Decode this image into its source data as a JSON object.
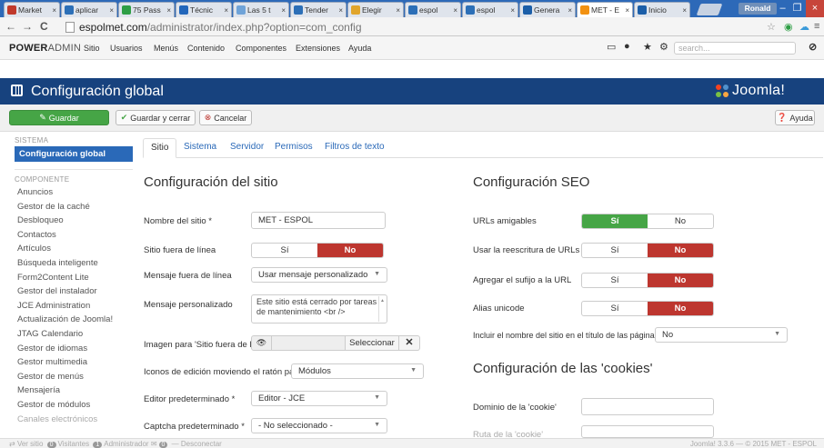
{
  "browser": {
    "tabs": [
      {
        "title": "Market",
        "color": "#c0392b",
        "active": false
      },
      {
        "title": "aplicar",
        "color": "#2c6fb7",
        "active": false
      },
      {
        "title": "75 Pass",
        "color": "#2e9e45",
        "active": false
      },
      {
        "title": "Técnic",
        "color": "#2266bb",
        "active": false
      },
      {
        "title": "Las 5 t",
        "color": "#6fa3d8",
        "active": false
      },
      {
        "title": "Tender",
        "color": "#2c6fb7",
        "active": false
      },
      {
        "title": "Elegir",
        "color": "#e1a52b",
        "active": false
      },
      {
        "title": "espol",
        "color": "#2c6fb7",
        "active": false
      },
      {
        "title": "espol",
        "color": "#2c6fb7",
        "active": false
      },
      {
        "title": "Genera",
        "color": "#1b5ea8",
        "active": false
      },
      {
        "title": "MET - E",
        "color": "#f29111",
        "active": true
      },
      {
        "title": "Inicio",
        "color": "#1b5ea8",
        "active": false
      }
    ],
    "tab_close": "×",
    "user": "Ronald",
    "window_controls": {
      "minimize": "–",
      "maximize": "❐",
      "close": "×"
    },
    "nav": {
      "back": "←",
      "forward": "→",
      "reload": "C"
    },
    "url_domain": "espolmet.com",
    "url_path": "/administrator/index.php?option=com_config",
    "ext_icons": [
      "☆",
      "◉",
      "☁",
      "≡"
    ]
  },
  "admin_bar": {
    "brand_a": "POWER",
    "brand_b": "ADMIN",
    "menu": [
      "Sitio",
      "Usuarios",
      "Menús",
      "Contenido",
      "Componentes",
      "Extensiones",
      "Ayuda"
    ],
    "search_placeholder": "search...",
    "icons": [
      "monitor-icon",
      "user-icon",
      "star-icon",
      "gear-icon",
      "joomla-icon"
    ]
  },
  "header": {
    "title": "Configuración global",
    "logo_text": "Joomla!"
  },
  "toolbar": {
    "save": "Guardar",
    "save_close": "Guardar y cerrar",
    "cancel": "Cancelar",
    "help": "Ayuda"
  },
  "sidebar": {
    "system_heading": "SISTEMA",
    "active_item": "Configuración global",
    "component_heading": "COMPONENTE",
    "items": [
      "Anuncios",
      "Gestor de la caché",
      "Desbloqueo",
      "Contactos",
      "Artículos",
      "Búsqueda inteligente",
      "Form2Content Lite",
      "Gestor del instalador",
      "JCE Administration",
      "Actualización de Joomla!",
      "JTAG Calendario",
      "Gestor de idiomas",
      "Gestor multimedia",
      "Gestor de menús",
      "Mensajería",
      "Gestor de módulos",
      "Canales electrónicos"
    ]
  },
  "tabs": [
    "Sitio",
    "Sistema",
    "Servidor",
    "Permisos",
    "Filtros de texto"
  ],
  "site": {
    "heading": "Configuración del sitio",
    "site_name_label": "Nombre del sitio *",
    "site_name_value": "MET - ESPOL",
    "offline_label": "Sitio fuera de línea",
    "offline_yes": "Sí",
    "offline_no": "No",
    "offline_msg_label": "Mensaje fuera de línea",
    "offline_msg_value": "Usar mensaje personalizado",
    "custom_msg_label": "Mensaje personalizado",
    "custom_msg_value": "Este sitio está cerrado por tareas de mantenimiento <br />",
    "offline_image_label": "Imagen para 'Sitio fuera de línea'",
    "select_button": "Seleccionar",
    "edit_icons_label": "Iconos de edición moviendo el ratón para",
    "edit_icons_value": "Módulos",
    "editor_label": "Editor predeterminado *",
    "editor_value": "Editor - JCE",
    "captcha_label": "Captcha predeterminado *",
    "captcha_value": "- No seleccionado -"
  },
  "seo": {
    "heading": "Configuración SEO",
    "friendly_label": "URLs amigables",
    "rewrite_label": "Usar la reescritura de URLs",
    "suffix_label": "Agregar el sufijo a la URL",
    "unicode_label": "Alias unicode",
    "yes": "Sí",
    "no": "No",
    "sitename_title_label": "Incluir el nombre del sitio en el título de las páginas",
    "sitename_title_value": "No"
  },
  "cookies": {
    "heading": "Configuración de las 'cookies'",
    "domain_label": "Dominio de la 'cookie'",
    "path_label": "Ruta de la 'cookie'"
  },
  "status": {
    "view_site": "Ver sitio",
    "visitors_count": "0",
    "visitors": "Visitantes",
    "admins_count": "1",
    "admins": "Administrador",
    "messages_count": "0",
    "logout": "Desconectar",
    "version": "Joomla! 3.3.6 — © 2015 MET - ESPOL"
  }
}
